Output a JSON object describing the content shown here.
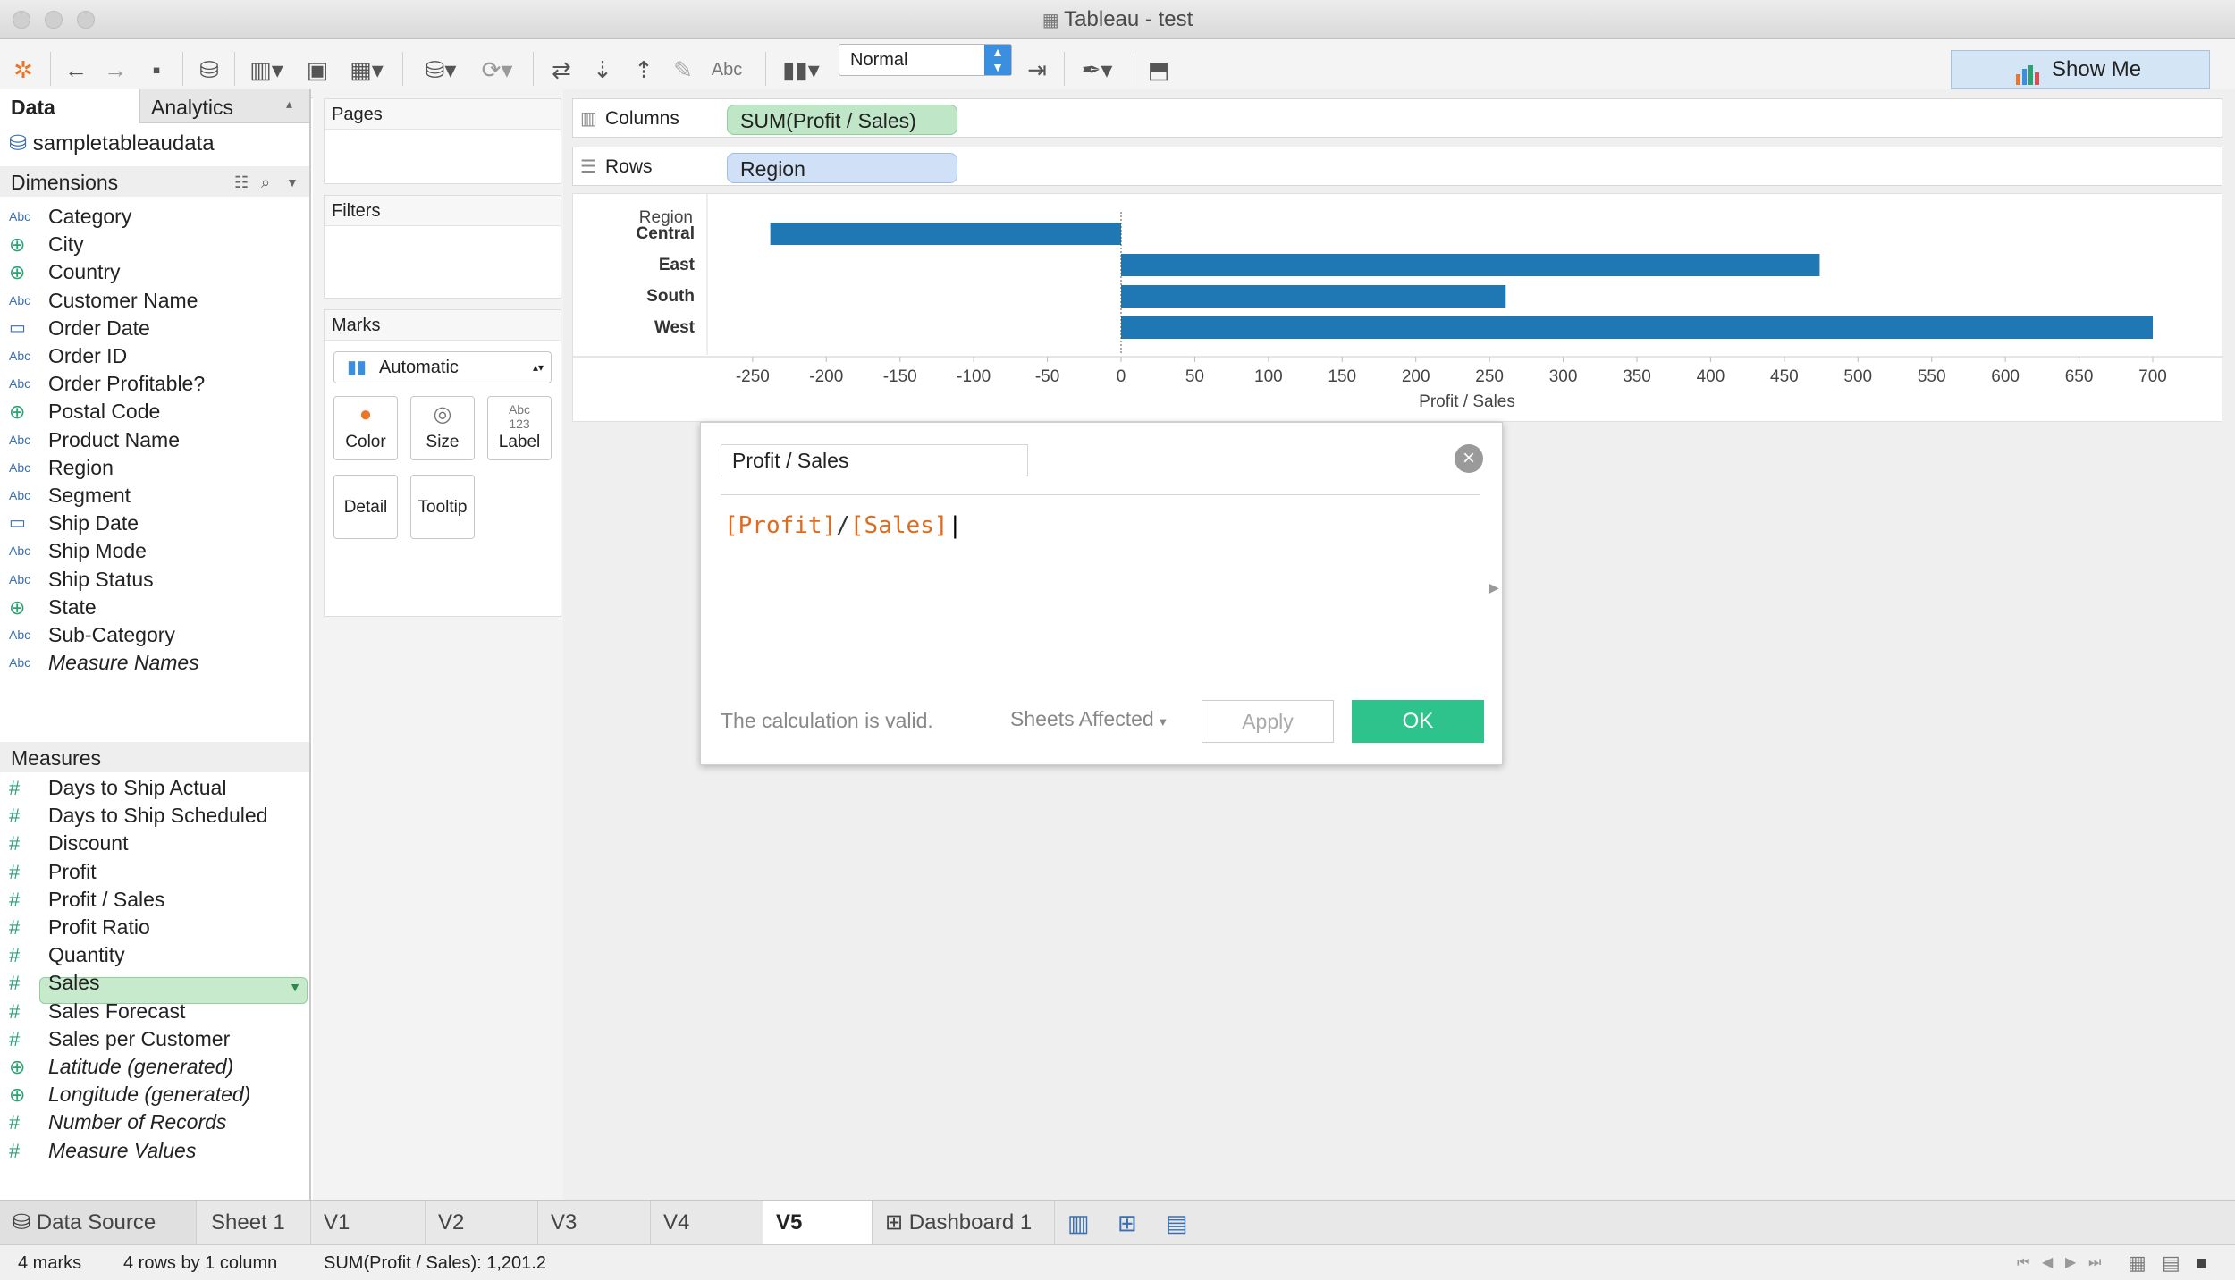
{
  "window": {
    "title": "Tableau - test"
  },
  "toolbar": {
    "fit_value": "Normal",
    "show_me": "Show Me",
    "abc": "Abc"
  },
  "panel_tabs": {
    "data": "Data",
    "analytics": "Analytics"
  },
  "data_source": "sampletableaudata",
  "dimensions": {
    "header": "Dimensions",
    "items": [
      {
        "icon": "Abc",
        "label": "Category"
      },
      {
        "icon": "globe",
        "label": "City"
      },
      {
        "icon": "globe",
        "label": "Country"
      },
      {
        "icon": "Abc",
        "label": "Customer Name"
      },
      {
        "icon": "calendar",
        "label": "Order Date"
      },
      {
        "icon": "Abc",
        "label": "Order ID"
      },
      {
        "icon": "Abc",
        "label": "Order Profitable?"
      },
      {
        "icon": "globe",
        "label": "Postal Code"
      },
      {
        "icon": "Abc",
        "label": "Product Name"
      },
      {
        "icon": "Abc",
        "label": "Region"
      },
      {
        "icon": "Abc",
        "label": "Segment"
      },
      {
        "icon": "calendar",
        "label": "Ship Date"
      },
      {
        "icon": "Abc",
        "label": "Ship Mode"
      },
      {
        "icon": "Abc",
        "label": "Ship Status"
      },
      {
        "icon": "globe",
        "label": "State"
      },
      {
        "icon": "Abc",
        "label": "Sub-Category"
      },
      {
        "icon": "Abc",
        "label": "Measure Names"
      }
    ]
  },
  "measures": {
    "header": "Measures",
    "items": [
      {
        "icon": "#",
        "label": "Days to Ship Actual"
      },
      {
        "icon": "#",
        "label": "Days to Ship Scheduled"
      },
      {
        "icon": "#",
        "label": "Discount"
      },
      {
        "icon": "#",
        "label": "Profit"
      },
      {
        "icon": "#",
        "label": "Profit / Sales"
      },
      {
        "icon": "#",
        "label": "Profit Ratio"
      },
      {
        "icon": "#",
        "label": "Quantity"
      },
      {
        "icon": "#",
        "label": "Sales"
      },
      {
        "icon": "#",
        "label": "Sales Forecast"
      },
      {
        "icon": "#",
        "label": "Sales per Customer"
      },
      {
        "icon": "globe",
        "label": "Latitude (generated)"
      },
      {
        "icon": "globe",
        "label": "Longitude (generated)"
      },
      {
        "icon": "#",
        "label": "Number of Records"
      },
      {
        "icon": "#",
        "label": "Measure Values"
      }
    ]
  },
  "shelves": {
    "pages": "Pages",
    "filters": "Filters",
    "marks": "Marks",
    "mark_type": "Automatic",
    "mark_buttons": [
      "Color",
      "Size",
      "Label",
      "Detail",
      "Tooltip"
    ],
    "label_icon_text": "Abc\n123",
    "columns_label": "Columns",
    "columns_pill": "SUM(Profit / Sales)",
    "rows_label": "Rows",
    "rows_pill": "Region"
  },
  "chart_data": {
    "type": "bar",
    "orientation": "horizontal",
    "category_header": "Region",
    "categories": [
      "Central",
      "East",
      "South",
      "West"
    ],
    "values": [
      -238,
      474,
      261,
      700
    ],
    "xlabel": "Profit / Sales",
    "xlim": [
      -270,
      720
    ],
    "ticks": [
      -250,
      -200,
      -150,
      -100,
      -50,
      0,
      50,
      100,
      150,
      200,
      250,
      300,
      350,
      400,
      450,
      500,
      550,
      600,
      650,
      700
    ],
    "color": "#1f77b4"
  },
  "calc_dialog": {
    "name": "Profit / Sales",
    "formula_a": "[Profit]",
    "formula_op": "/",
    "formula_b": "[Sales]",
    "valid_message": "The calculation is valid.",
    "sheets_affected": "Sheets Affected",
    "apply": "Apply",
    "ok": "OK"
  },
  "sheet_tabs": {
    "data_source": "Data Source",
    "tabs": [
      "Sheet 1",
      "V1",
      "V2",
      "V3",
      "V4",
      "V5"
    ],
    "active": "V5",
    "dashboard": "Dashboard 1"
  },
  "status": {
    "marks": "4 marks",
    "dims": "4 rows by 1 column",
    "sum": "SUM(Profit / Sales): 1,201.2"
  }
}
